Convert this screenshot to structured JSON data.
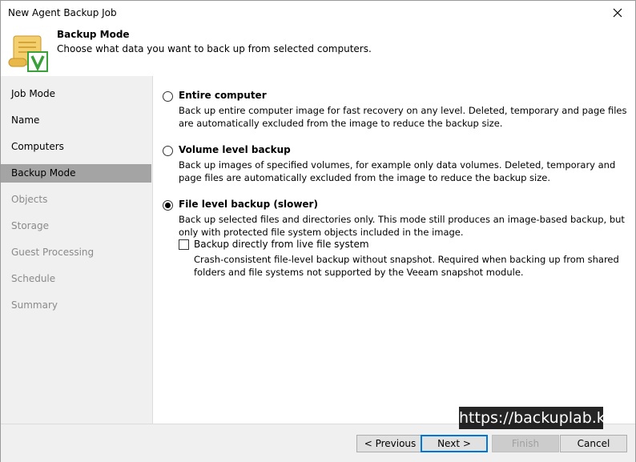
{
  "window": {
    "title": "New Agent Backup Job"
  },
  "header": {
    "title": "Backup Mode",
    "description": "Choose what data you want to back up from selected computers.",
    "icon": "backup-scroll-v-icon"
  },
  "sidebar": {
    "items": [
      {
        "label": "Job Mode",
        "state": "enabled"
      },
      {
        "label": "Name",
        "state": "enabled"
      },
      {
        "label": "Computers",
        "state": "enabled"
      },
      {
        "label": "Backup Mode",
        "state": "selected"
      },
      {
        "label": "Objects",
        "state": "disabled"
      },
      {
        "label": "Storage",
        "state": "disabled"
      },
      {
        "label": "Guest Processing",
        "state": "disabled"
      },
      {
        "label": "Schedule",
        "state": "disabled"
      },
      {
        "label": "Summary",
        "state": "disabled"
      }
    ]
  },
  "options": {
    "entire": {
      "label": "Entire computer",
      "description": "Back up entire computer image for fast recovery on any level. Deleted, temporary and page files are automatically excluded from the image to reduce the backup size.",
      "checked": false
    },
    "volume": {
      "label": "Volume level backup",
      "description": "Back up images of specified volumes, for example only data volumes. Deleted, temporary and page files are automatically excluded from the image to reduce the backup size.",
      "checked": false
    },
    "file": {
      "label": "File level backup (slower)",
      "description": "Back up selected files and directories only. This mode still produces an image-based backup, but only with protected file system objects included in the image.",
      "checked": true,
      "sub": {
        "label": "Backup directly from live file system",
        "description": "Crash-consistent file-level backup without snapshot. Required when backing up from shared folders and file systems not supported by the Veeam snapshot module.",
        "checked": false
      }
    }
  },
  "footer": {
    "previous": "< Previous",
    "next": "Next >",
    "finish": "Finish",
    "cancel": "Cancel"
  },
  "watermark": "https://backuplab.kr",
  "colors": {
    "selected_bg": "#a4a4a4",
    "sidebar_bg": "#f0f0f0",
    "accent": "#0078d7",
    "icon_gold": "#e8b84a",
    "icon_green": "#3aa03a"
  }
}
